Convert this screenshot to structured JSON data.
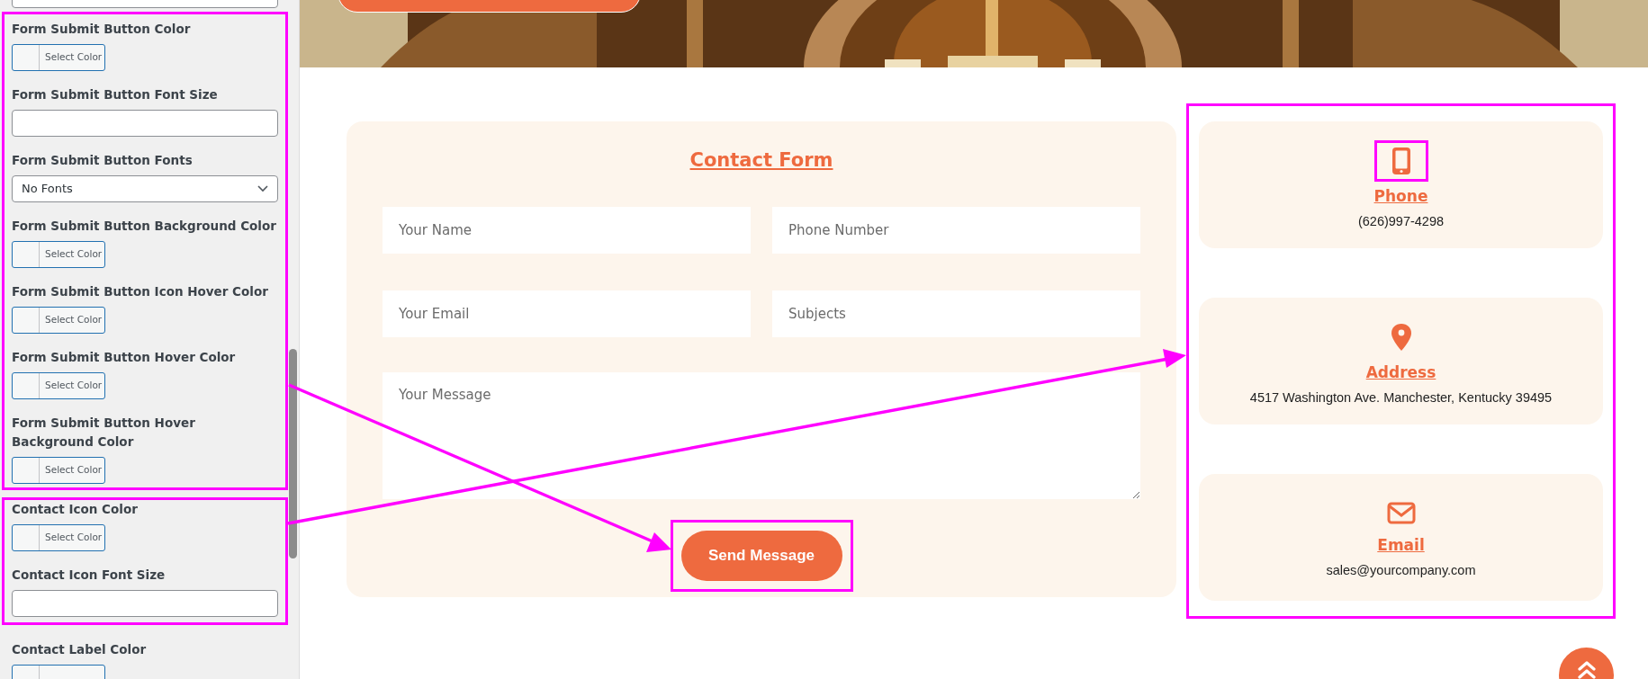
{
  "sidebar": {
    "groups": [
      {
        "highlighted": false,
        "fields": [
          {
            "kind": "text"
          }
        ]
      },
      {
        "highlighted": true,
        "fields": [
          {
            "kind": "color",
            "label": "Form Submit Button Color",
            "button_text": "Select Color"
          },
          {
            "kind": "text",
            "label": "Form Submit Button Font Size"
          },
          {
            "kind": "select",
            "label": "Form Submit Button Fonts",
            "value": "No Fonts"
          },
          {
            "kind": "color",
            "label": "Form Submit Button Background Color",
            "button_text": "Select Color"
          },
          {
            "kind": "color",
            "label": "Form Submit Button Icon Hover Color",
            "button_text": "Select Color"
          },
          {
            "kind": "color",
            "label": "Form Submit Button Hover Color",
            "button_text": "Select Color"
          },
          {
            "kind": "color",
            "label": "Form Submit Button Hover Background Color",
            "button_text": "Select Color"
          }
        ]
      },
      {
        "highlighted": true,
        "fields": [
          {
            "kind": "color",
            "label": "Contact Icon Color",
            "button_text": "Select Color"
          },
          {
            "kind": "text",
            "label": "Contact Icon Font Size"
          }
        ]
      },
      {
        "highlighted": false,
        "fields": [
          {
            "kind": "color",
            "label": "Contact Label Color"
          }
        ]
      }
    ]
  },
  "contact_form": {
    "title": "Contact Form",
    "fields": [
      {
        "kind": "input",
        "placeholder": "Your Name"
      },
      {
        "kind": "input",
        "placeholder": "Phone Number"
      },
      {
        "kind": "input",
        "placeholder": "Your Email"
      },
      {
        "kind": "input",
        "placeholder": "Subjects"
      },
      {
        "kind": "textarea",
        "placeholder": "Your Message"
      }
    ],
    "submit": {
      "label": "Send Message",
      "highlighted": true
    }
  },
  "contact_cards": {
    "highlighted": true,
    "items": [
      {
        "kind": "phone",
        "label": "Phone",
        "value": "(626)997-4298",
        "icon_highlighted": true
      },
      {
        "kind": "address",
        "label": "Address",
        "value": "4517 Washington Ave. Manchester, Kentucky 39495",
        "icon_highlighted": false
      },
      {
        "kind": "email",
        "label": "Email",
        "value": "sales@yourcompany.com",
        "icon_highlighted": false
      }
    ]
  }
}
